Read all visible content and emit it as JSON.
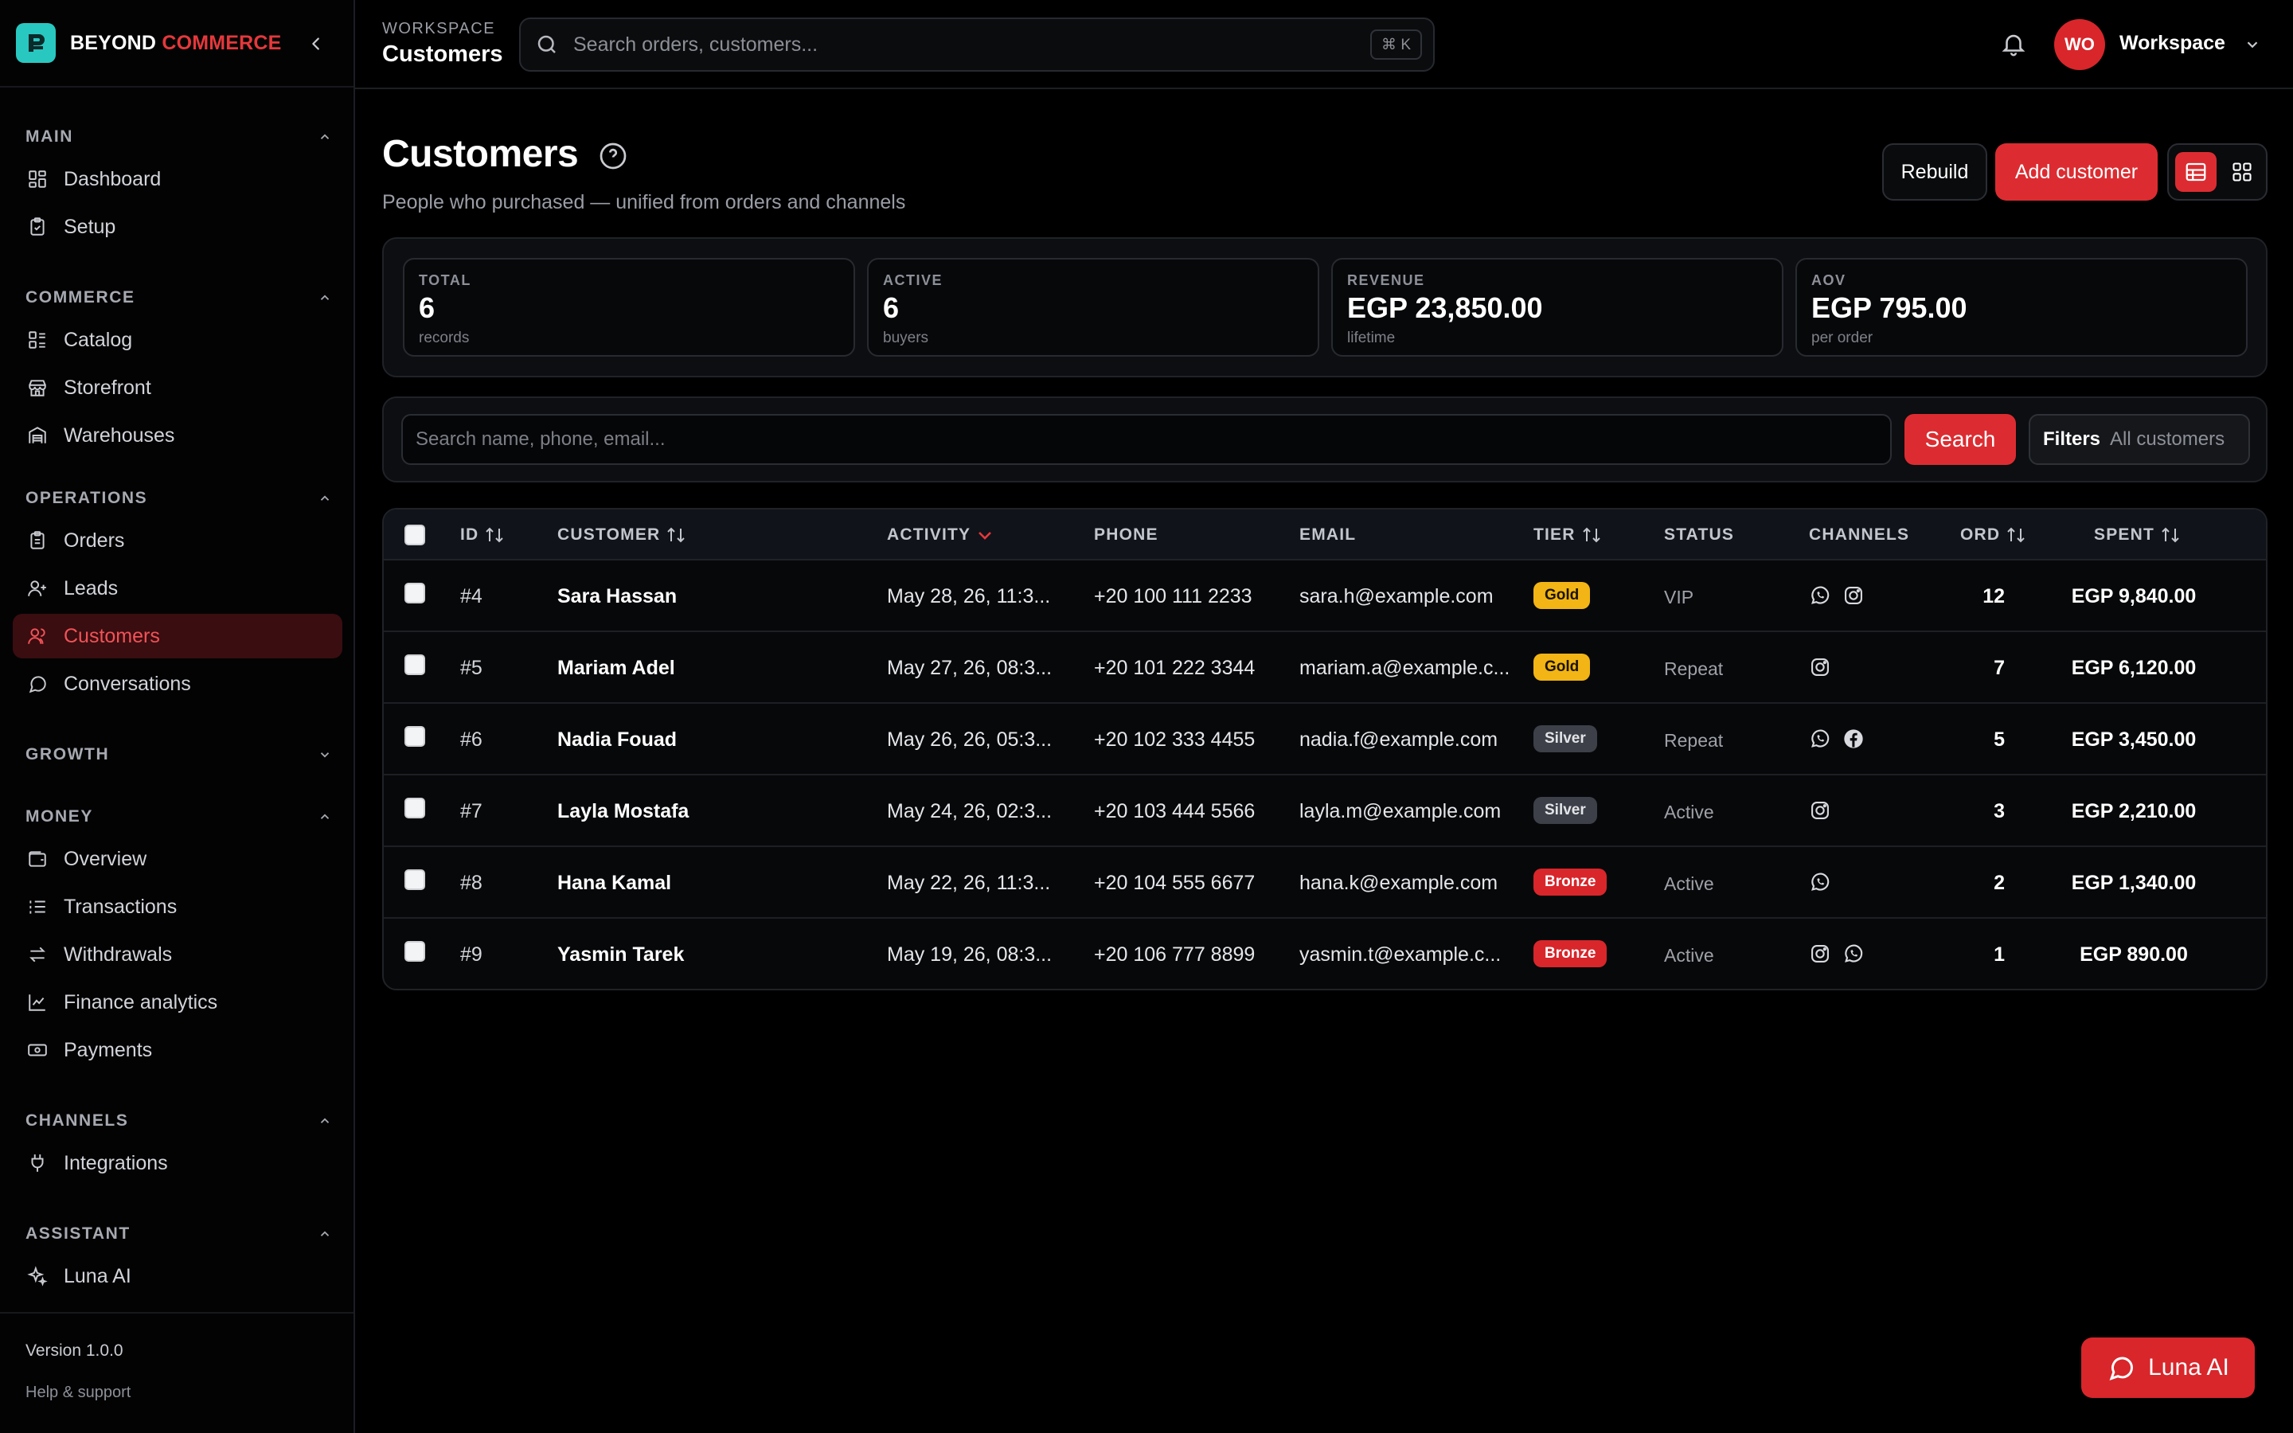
{
  "app": {
    "brand_a": "BEYOND",
    "brand_b": "COMMERCE"
  },
  "sidebar": {
    "sections": [
      {
        "label": "MAIN"
      },
      {
        "label": "COMMERCE"
      },
      {
        "label": "OPERATIONS"
      },
      {
        "label": "GROWTH"
      },
      {
        "label": "MONEY"
      },
      {
        "label": "CHANNELS"
      },
      {
        "label": "ASSISTANT"
      }
    ],
    "items": [
      {
        "label": "Dashboard",
        "icon": "grid-icon"
      },
      {
        "label": "Setup",
        "icon": "clipboard-check-icon"
      },
      {
        "label": "Catalog",
        "icon": "list-icon"
      },
      {
        "label": "Storefront",
        "icon": "store-icon"
      },
      {
        "label": "Warehouses",
        "icon": "warehouse-icon"
      },
      {
        "label": "Orders",
        "icon": "clipboard-icon"
      },
      {
        "label": "Leads",
        "icon": "user-plus-icon"
      },
      {
        "label": "Customers",
        "icon": "users-icon",
        "active": true
      },
      {
        "label": "Conversations",
        "icon": "chat-icon"
      },
      {
        "label": "Overview",
        "icon": "wallet-icon"
      },
      {
        "label": "Transactions",
        "icon": "list-ordered-icon"
      },
      {
        "label": "Withdrawals",
        "icon": "arrows-swap-icon"
      },
      {
        "label": "Finance analytics",
        "icon": "line-chart-icon"
      },
      {
        "label": "Payments",
        "icon": "banknote-icon"
      },
      {
        "label": "Integrations",
        "icon": "plug-icon"
      },
      {
        "label": "Luna AI",
        "icon": "sparkles-icon"
      }
    ],
    "version": "Version 1.0.0",
    "help": "Help & support"
  },
  "topbar": {
    "crumb_top": "WORKSPACE",
    "crumb_title": "Customers",
    "search_placeholder": "Search orders, customers...",
    "shortcut": "⌘ K",
    "avatar_initials": "WO",
    "workspace_name": "Workspace"
  },
  "header": {
    "title": "Customers",
    "subtitle": "People who purchased — unified from orders and channels",
    "rebuild_label": "Rebuild",
    "add_label": "Add customer"
  },
  "stats": [
    {
      "label": "TOTAL",
      "value": "6",
      "sub": "records"
    },
    {
      "label": "ACTIVE",
      "value": "6",
      "sub": "buyers"
    },
    {
      "label": "REVENUE",
      "value": "EGP 23,850.00",
      "sub": "lifetime"
    },
    {
      "label": "AOV",
      "value": "EGP 795.00",
      "sub": "per order"
    }
  ],
  "filters": {
    "search_placeholder": "Search name, phone, email...",
    "search_label": "Search",
    "filters_label": "Filters",
    "filters_value": "All customers"
  },
  "table": {
    "columns": [
      "ID",
      "CUSTOMER",
      "ACTIVITY",
      "PHONE",
      "EMAIL",
      "TIER",
      "STATUS",
      "CHANNELS",
      "ORD",
      "SPENT"
    ],
    "rows": [
      {
        "id": "#4",
        "name": "Sara Hassan",
        "activity": "May 28, 26, 11:3...",
        "phone": "+20 100 111 2233",
        "email": "sara.h@example.com",
        "tier": "Gold",
        "status": "VIP",
        "channels": [
          "whatsapp-icon",
          "instagram-icon"
        ],
        "orders": "12",
        "spent": "EGP 9,840.00"
      },
      {
        "id": "#5",
        "name": "Mariam Adel",
        "activity": "May 27, 26, 08:3...",
        "phone": "+20 101 222 3344",
        "email": "mariam.a@example.c...",
        "tier": "Gold",
        "status": "Repeat",
        "channels": [
          "instagram-icon"
        ],
        "orders": "7",
        "spent": "EGP 6,120.00"
      },
      {
        "id": "#6",
        "name": "Nadia Fouad",
        "activity": "May 26, 26, 05:3...",
        "phone": "+20 102 333 4455",
        "email": "nadia.f@example.com",
        "tier": "Silver",
        "status": "Repeat",
        "channels": [
          "whatsapp-icon",
          "facebook-icon"
        ],
        "orders": "5",
        "spent": "EGP 3,450.00"
      },
      {
        "id": "#7",
        "name": "Layla Mostafa",
        "activity": "May 24, 26, 02:3...",
        "phone": "+20 103 444 5566",
        "email": "layla.m@example.com",
        "tier": "Silver",
        "status": "Active",
        "channels": [
          "instagram-icon"
        ],
        "orders": "3",
        "spent": "EGP 2,210.00"
      },
      {
        "id": "#8",
        "name": "Hana Kamal",
        "activity": "May 22, 26, 11:3...",
        "phone": "+20 104 555 6677",
        "email": "hana.k@example.com",
        "tier": "Bronze",
        "status": "Active",
        "channels": [
          "whatsapp-icon"
        ],
        "orders": "2",
        "spent": "EGP 1,340.00"
      },
      {
        "id": "#9",
        "name": "Yasmin Tarek",
        "activity": "May 19, 26, 08:3...",
        "phone": "+20 106 777 8899",
        "email": "yasmin.t@example.c...",
        "tier": "Bronze",
        "status": "Active",
        "channels": [
          "instagram-icon",
          "whatsapp-icon"
        ],
        "orders": "1",
        "spent": "EGP 890.00"
      }
    ]
  },
  "fab": {
    "label": "Luna AI"
  },
  "colors": {
    "accent": "#dc2c31",
    "gold": "#f2b515",
    "silver": "#3d4048",
    "bronze": "#d8262b",
    "brand_logo": "#28c8c0"
  }
}
